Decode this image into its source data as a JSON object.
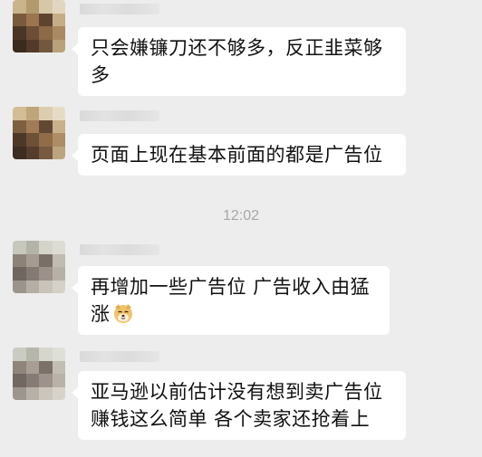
{
  "chat": {
    "timestamp": "12:02",
    "messages": [
      {
        "text": "只会嫌镰刀还不够多，反正韭菜够多",
        "emoji": ""
      },
      {
        "text": "页面上现在基本前面的都是广告位",
        "emoji": ""
      },
      {
        "text": "再增加一些广告位 广告收入由猛涨",
        "emoji": "doge-emoji"
      },
      {
        "text": "亚马逊以前估计没有想到卖广告位赚钱这么简单 各个卖家还抢着上",
        "emoji": ""
      }
    ]
  },
  "colors": {
    "background": "#ededed",
    "bubble": "#ffffff",
    "text": "#111111",
    "timestamp": "#a8a8a8"
  }
}
